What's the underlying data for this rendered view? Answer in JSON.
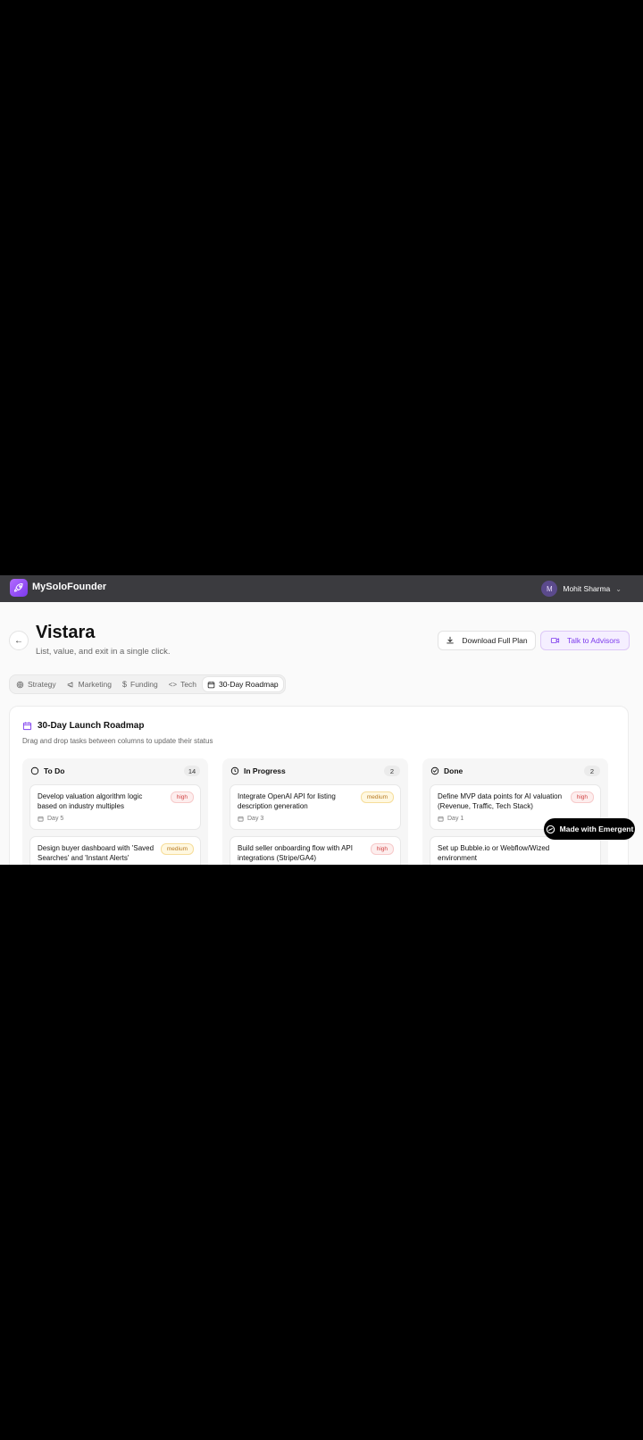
{
  "app": {
    "name": "MySoloFounder"
  },
  "user": {
    "initial": "M",
    "name": "Mohit Sharma"
  },
  "page": {
    "title": "Vistara",
    "subtitle": "List, value, and exit in a single click."
  },
  "actions": {
    "download_label": "Download Full Plan",
    "advisors_label": "Talk to Advisors"
  },
  "tabs": [
    {
      "label": "Strategy",
      "icon": "target-icon"
    },
    {
      "label": "Marketing",
      "icon": "megaphone-icon"
    },
    {
      "label": "Funding",
      "icon": "dollar-icon"
    },
    {
      "label": "Tech",
      "icon": "code-icon"
    },
    {
      "label": "30-Day Roadmap",
      "icon": "calendar-icon",
      "active": true
    }
  ],
  "roadmap": {
    "title": "30-Day Launch Roadmap",
    "subtitle": "Drag and drop tasks between columns to update their status",
    "columns": [
      {
        "name": "To Do",
        "count": "14",
        "icon": "circle-icon",
        "tasks": [
          {
            "text": "Develop valuation algorithm logic based on industry multiples",
            "priority": "high",
            "day": "Day 5"
          },
          {
            "text": "Design buyer dashboard with 'Saved Searches' and 'Instant Alerts'",
            "priority": "medium",
            "day": ""
          }
        ]
      },
      {
        "name": "In Progress",
        "count": "2",
        "icon": "clock-icon",
        "tasks": [
          {
            "text": "Integrate OpenAI API for listing description generation",
            "priority": "medium",
            "day": "Day 3"
          },
          {
            "text": "Build seller onboarding flow with API integrations (Stripe/GA4)",
            "priority": "high",
            "day": ""
          }
        ]
      },
      {
        "name": "Done",
        "count": "2",
        "icon": "check-circle-icon",
        "tasks": [
          {
            "text": "Define MVP data points for AI valuation (Revenue, Traffic, Tech Stack)",
            "priority": "high",
            "day": "Day 1"
          },
          {
            "text": "Set up Bubble.io or Webflow/Wized environment",
            "priority": "",
            "day": ""
          }
        ]
      }
    ]
  },
  "badge": {
    "label": "Made with Emergent"
  },
  "colors": {
    "brand": "#7c3aed",
    "topbar": "#3b3b3f",
    "high": "#d14343",
    "medium": "#b7791f"
  }
}
